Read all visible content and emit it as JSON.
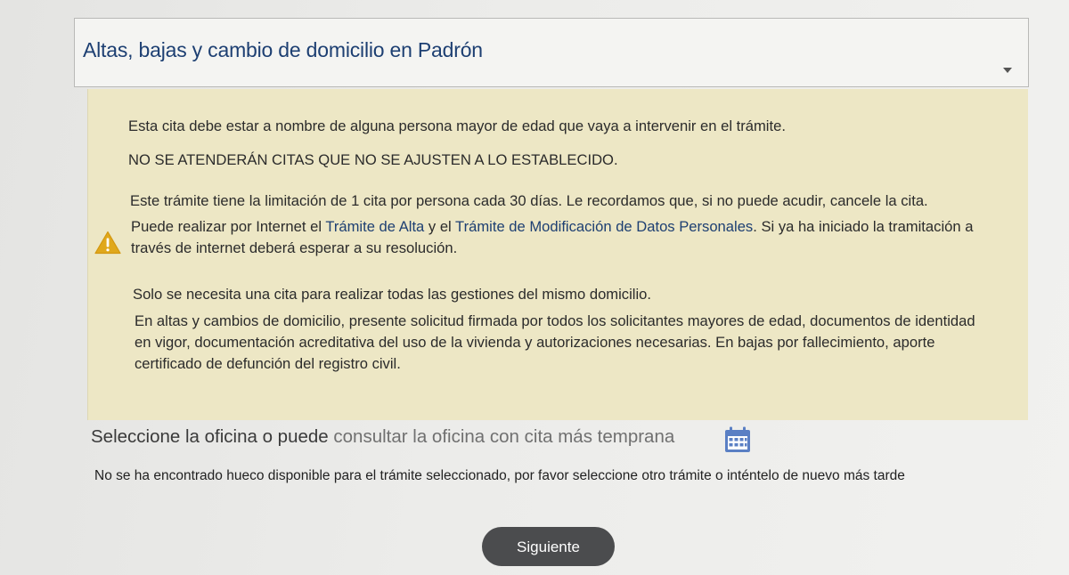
{
  "service_select": {
    "selected": "Altas, bajas y cambio de domicilio en Padrón"
  },
  "notice": {
    "line1": "Esta cita debe estar a nombre de alguna persona mayor de edad que vaya a intervenir en el trámite.",
    "line2": "NO SE ATENDERÁN CITAS QUE NO SE AJUSTEN A LO ESTABLECIDO.",
    "line3": "Este trámite tiene la limitación de 1 cita por persona cada 30 días. Le recordamos que, si no puede acudir, cancele la cita.",
    "line4_prefix": "Puede realizar por Internet el ",
    "link_alta": "Trámite de Alta",
    "line4_mid": " y el ",
    "link_modificacion": "Trámite de Modificación de Datos Personales",
    "line4_suffix": ". Si ya ha iniciado la tramitación a través de internet deberá esperar a su resolución.",
    "line5": "Solo se necesita una cita para realizar todas las gestiones del mismo domicilio.",
    "line6": "En altas y cambios de domicilio, presente solicitud firmada por todos los solicitantes mayores de edad, documentos de identidad en vigor, documentación acreditativa del uso de la vivienda y autorizaciones necesarias. En bajas por fallecimiento, aporte certificado de defunción del registro civil.",
    "icon": "warning-icon",
    "warning_color": "#e0a81c"
  },
  "office": {
    "label": "Seleccione la oficina o puede",
    "link": "consultar la oficina con cita más temprana",
    "icon": "calendar-icon",
    "icon_color": "#5a7fc4"
  },
  "message": {
    "no_slot": "No se ha encontrado hueco disponible para el trámite seleccionado, por favor seleccione otro trámite o inténtelo de nuevo más tarde"
  },
  "actions": {
    "next_label": "Siguiente"
  }
}
